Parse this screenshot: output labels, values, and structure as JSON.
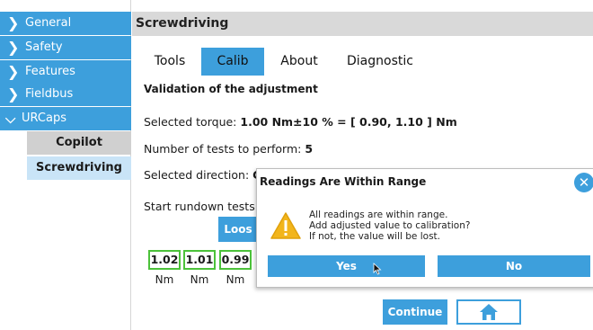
{
  "sidebar": {
    "items": [
      {
        "label": "General",
        "icon": "chevron-right"
      },
      {
        "label": "Safety",
        "icon": "chevron-right"
      },
      {
        "label": "Features",
        "icon": "chevron-right"
      },
      {
        "label": "Fieldbus",
        "icon": "chevron-right"
      },
      {
        "label": "URCaps",
        "icon": "chevron-down"
      }
    ],
    "sub_items": [
      {
        "label": "Copilot"
      },
      {
        "label": "Screwdriving"
      }
    ]
  },
  "header": {
    "title": "Screwdriving"
  },
  "tabs": [
    {
      "label": "Tools"
    },
    {
      "label": "Calib",
      "active": true
    },
    {
      "label": "About"
    },
    {
      "label": "Diagnostic"
    }
  ],
  "content": {
    "section_title": "Validation of the adjustment",
    "torque_label": "Selected torque: ",
    "torque_value": "1.00 Nm±10 % = [ 0.90, 1.10 ] Nm",
    "tests_label": "Number of tests to perform: ",
    "tests_value": "5",
    "direction_label": "Selected direction: ",
    "direction_value": "CW",
    "rundown_label": "Start rundown tests a",
    "loosen_label": "Loos",
    "readings": [
      "1.02",
      "1.01",
      "0.99"
    ],
    "unit": "Nm",
    "continue_label": "Continue",
    "home_icon": "home-icon"
  },
  "dialog": {
    "title": "Readings Are Within Range",
    "close_icon": "close-icon",
    "warning_icon": "warning-icon",
    "messages": [
      "All readings are within range.",
      "Add adjusted value to calibration?",
      "If not, the value will be lost."
    ],
    "yes_label": "Yes",
    "no_label": "No"
  },
  "colors": {
    "accent": "#3d9fdc",
    "reading_border": "#4cc23a",
    "warning": "#f2b51b",
    "header_bg": "#d9d9d9"
  }
}
